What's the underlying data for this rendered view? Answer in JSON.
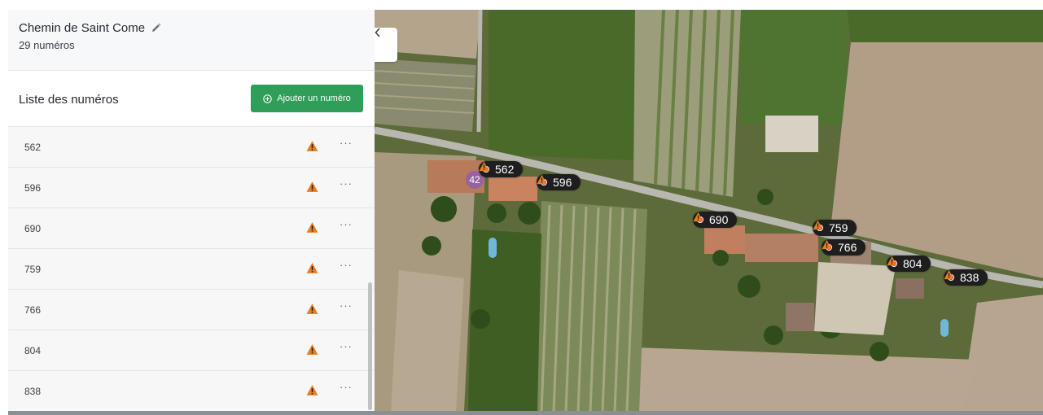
{
  "street": {
    "name": "Chemin de Saint Come",
    "count_label": "29 numéros"
  },
  "list": {
    "title": "Liste des numéros",
    "add_button_label": "Ajouter un numéro",
    "menu_label": "···",
    "items": [
      {
        "number": "562",
        "warning": true
      },
      {
        "number": "596",
        "warning": true
      },
      {
        "number": "690",
        "warning": true
      },
      {
        "number": "759",
        "warning": true
      },
      {
        "number": "766",
        "warning": true
      },
      {
        "number": "804",
        "warning": true
      },
      {
        "number": "838",
        "warning": true
      }
    ]
  },
  "map": {
    "cluster_label": "42",
    "markers": [
      {
        "number": "562"
      },
      {
        "number": "596"
      },
      {
        "number": "690"
      },
      {
        "number": "759"
      },
      {
        "number": "766"
      },
      {
        "number": "804"
      },
      {
        "number": "838"
      }
    ]
  },
  "colors": {
    "accent_green": "#2e9e58",
    "warning_orange": "#e67e22",
    "marker_dot": "#e0197e",
    "marker_bg": "#1e1e1e"
  },
  "icons": {
    "edit": "pencil-icon",
    "add": "plus-circle-icon",
    "warning": "warning-triangle-icon",
    "more": "more-horizontal-icon",
    "collapse": "chevron-left-icon"
  }
}
